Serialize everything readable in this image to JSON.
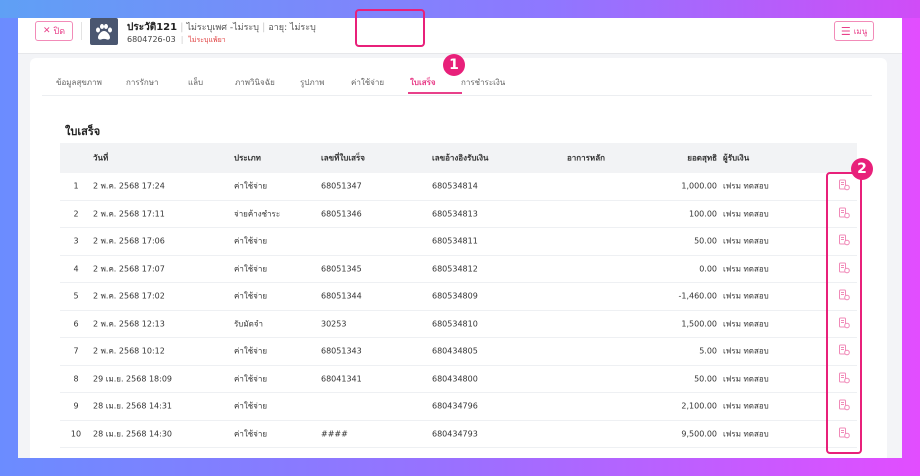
{
  "header": {
    "close_label": "ปิด",
    "pet_name": "ประวัติ121",
    "breed": "ไม่ระบุเพศ -ไม่ระบุ",
    "age": "อายุ: ไม่ระบุ",
    "pet_id": "6804726-03",
    "allergy": "ไม่ระบุแพ้ยา",
    "menu_label": "เมนู"
  },
  "tabs": [
    {
      "label": "ข้อมูลสุขภาพ"
    },
    {
      "label": "การรักษา"
    },
    {
      "label": "แล็บ"
    },
    {
      "label": "ภาพวินิจฉัย"
    },
    {
      "label": "รูปภาพ"
    },
    {
      "label": "ค่าใช้จ่าย"
    },
    {
      "label": "ใบเสร็จ",
      "active": true
    },
    {
      "label": "การชำระเงิน"
    }
  ],
  "annotations": {
    "badge1": "1",
    "badge2": "2"
  },
  "section_title": "ใบเสร็จ",
  "columns": [
    "",
    "วันที่",
    "ประเภท",
    "เลขที่ใบเสร็จ",
    "เลขอ้างอิงรับเงิน",
    "อาการหลัก",
    "ยอดสุทธิ",
    "ผู้รับเงิน"
  ],
  "rows": [
    {
      "num": "1",
      "date": "2 พ.ค. 2568 17:24",
      "type": "ค่าใช้จ่าย",
      "receipt": "68051347",
      "ref": "680534814",
      "symptom": "",
      "net": "1,000.00",
      "receiver": "เฟรม ทดสอบ"
    },
    {
      "num": "2",
      "date": "2 พ.ค. 2568 17:11",
      "type": "จ่ายค้างชำระ",
      "receipt": "68051346",
      "ref": "680534813",
      "symptom": "",
      "net": "100.00",
      "receiver": "เฟรม ทดสอบ"
    },
    {
      "num": "3",
      "date": "2 พ.ค. 2568 17:06",
      "type": "ค่าใช้จ่าย",
      "receipt": "",
      "ref": "680534811",
      "symptom": "",
      "net": "50.00",
      "receiver": "เฟรม ทดสอบ"
    },
    {
      "num": "4",
      "date": "2 พ.ค. 2568 17:07",
      "type": "ค่าใช้จ่าย",
      "receipt": "68051345",
      "ref": "680534812",
      "symptom": "",
      "net": "0.00",
      "receiver": "เฟรม ทดสอบ"
    },
    {
      "num": "5",
      "date": "2 พ.ค. 2568 17:02",
      "type": "ค่าใช้จ่าย",
      "receipt": "68051344",
      "ref": "680534809",
      "symptom": "",
      "net": "-1,460.00",
      "receiver": "เฟรม ทดสอบ"
    },
    {
      "num": "6",
      "date": "2 พ.ค. 2568 12:13",
      "type": "รับมัดจำ",
      "receipt": "30253",
      "ref": "680534810",
      "symptom": "",
      "net": "1,500.00",
      "receiver": "เฟรม ทดสอบ"
    },
    {
      "num": "7",
      "date": "2 พ.ค. 2568 10:12",
      "type": "ค่าใช้จ่าย",
      "receipt": "68051343",
      "ref": "680434805",
      "symptom": "",
      "net": "5.00",
      "receiver": "เฟรม ทดสอบ"
    },
    {
      "num": "8",
      "date": "29 เม.ย. 2568 18:09",
      "type": "ค่าใช้จ่าย",
      "receipt": "68041341",
      "ref": "680434800",
      "symptom": "",
      "net": "50.00",
      "receiver": "เฟรม ทดสอบ"
    },
    {
      "num": "9",
      "date": "28 เม.ย. 2568 14:31",
      "type": "ค่าใช้จ่าย",
      "receipt": "",
      "ref": "680434796",
      "symptom": "",
      "net": "2,100.00",
      "receiver": "เฟรม ทดสอบ"
    },
    {
      "num": "10",
      "date": "28 เม.ย. 2568 14:30",
      "type": "ค่าใช้จ่าย",
      "receipt": "####",
      "ref": "680434793",
      "symptom": "",
      "net": "9,500.00",
      "receiver": "เฟรม ทดสอบ"
    }
  ],
  "colors": {
    "accent": "#e8408a",
    "highlight": "#e8207a"
  }
}
